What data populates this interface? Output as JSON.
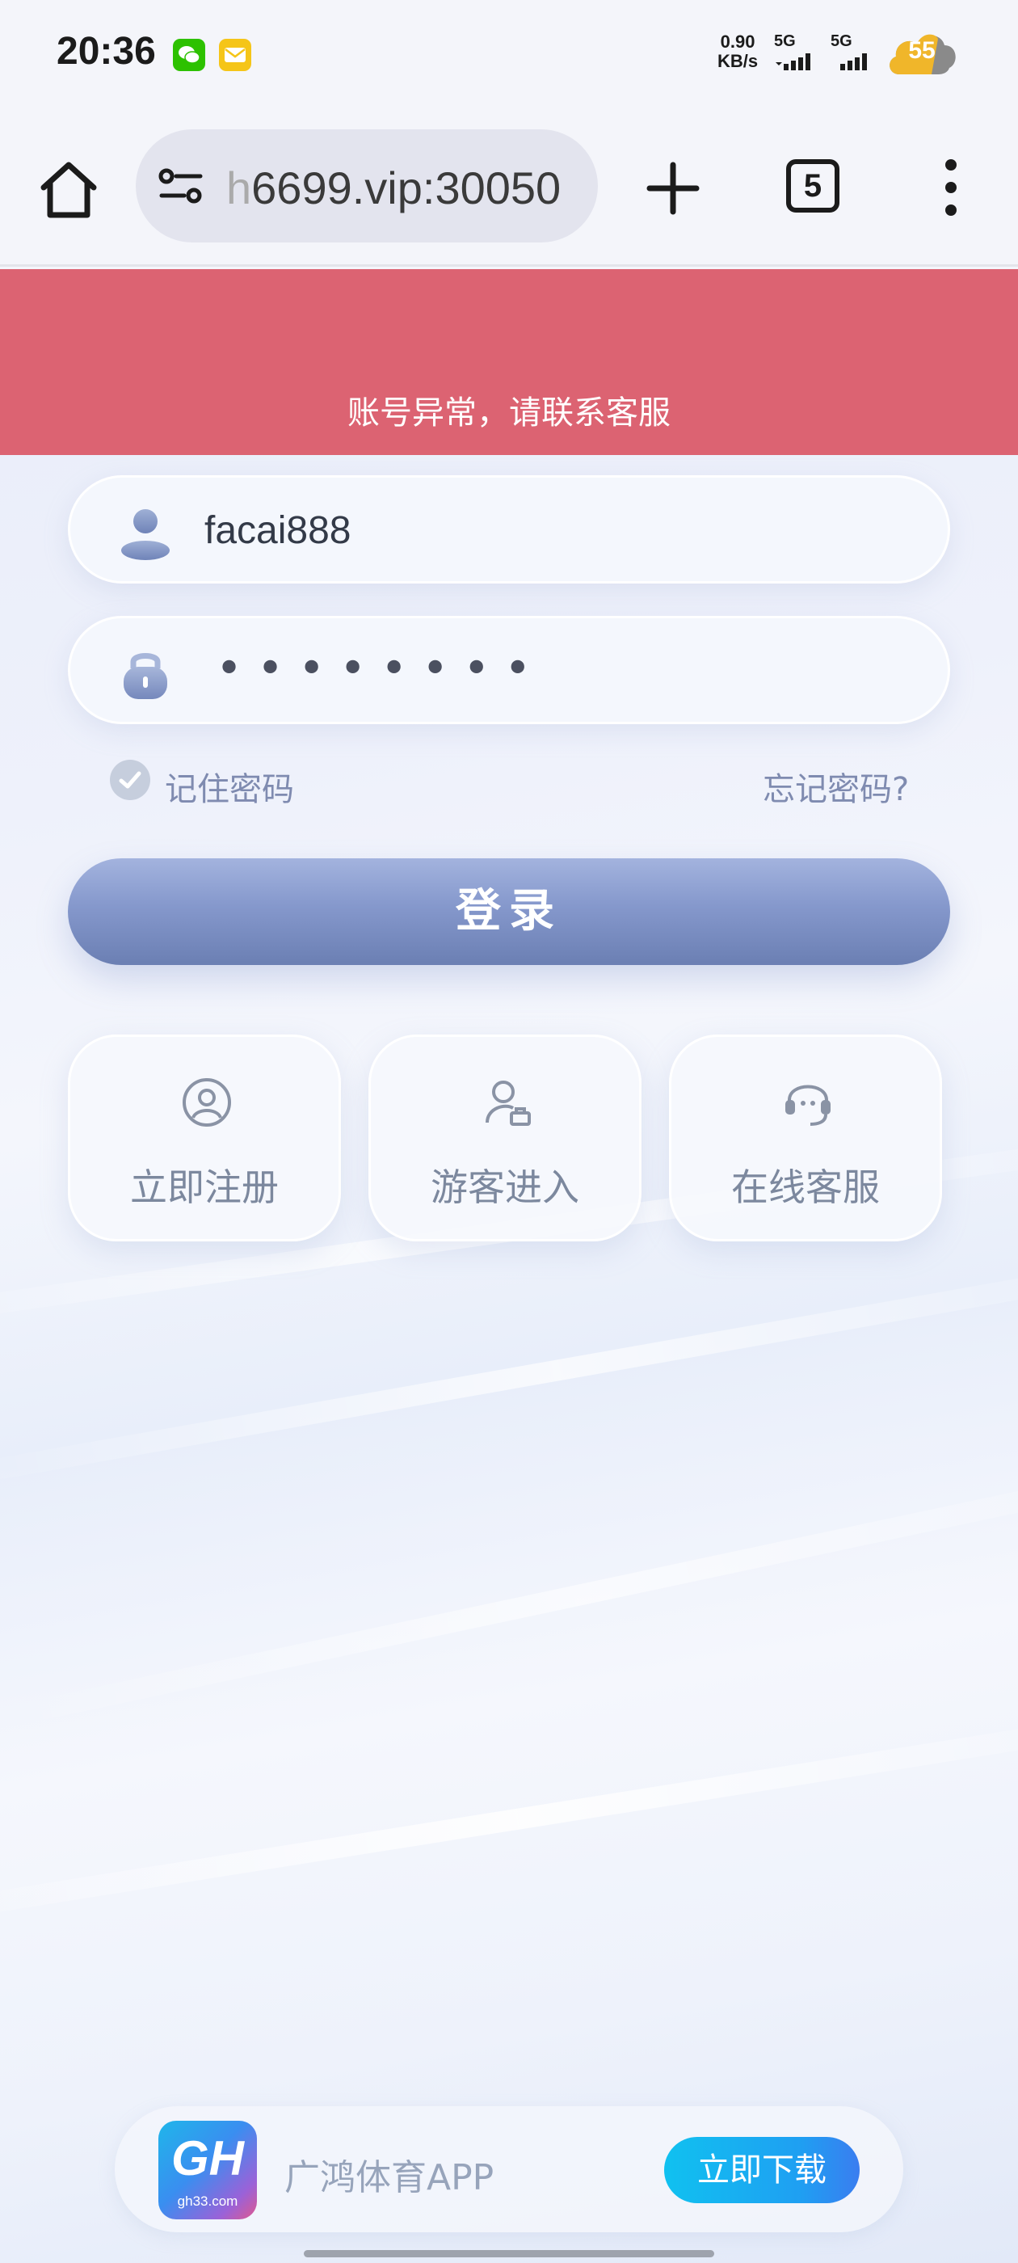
{
  "status_bar": {
    "time": "20:36",
    "net_speed_value": "0.90",
    "net_speed_unit": "KB/s",
    "signal_1_label": "5G",
    "signal_2_label": "5G",
    "battery_level": "55",
    "notification_icons": [
      "wechat-icon",
      "mail-icon"
    ]
  },
  "browser": {
    "url_faded_prefix": "h",
    "url_text": "6699.vip:30050",
    "tab_count": "5"
  },
  "banner": {
    "error_text": "账号异常，请联系客服",
    "color": "#dc6372"
  },
  "login_form": {
    "username_value": "facai888",
    "password_mask": "••••••••",
    "remember_label": "记住密码",
    "forgot_label": "忘记密码?",
    "login_label": "登录"
  },
  "quick_actions": [
    {
      "label": "立即注册",
      "icon": "user-circle-icon"
    },
    {
      "label": "游客进入",
      "icon": "guest-user-icon"
    },
    {
      "label": "在线客服",
      "icon": "headset-icon"
    }
  ],
  "app_promo": {
    "logo_text": "GH",
    "logo_subtext": "gh33.com",
    "app_name": "广鸿体育APP",
    "download_label": "立即下载"
  },
  "colors": {
    "accent": "#7f8bb0",
    "login_button": "#8598cc",
    "download_button": "#10c1f0"
  }
}
